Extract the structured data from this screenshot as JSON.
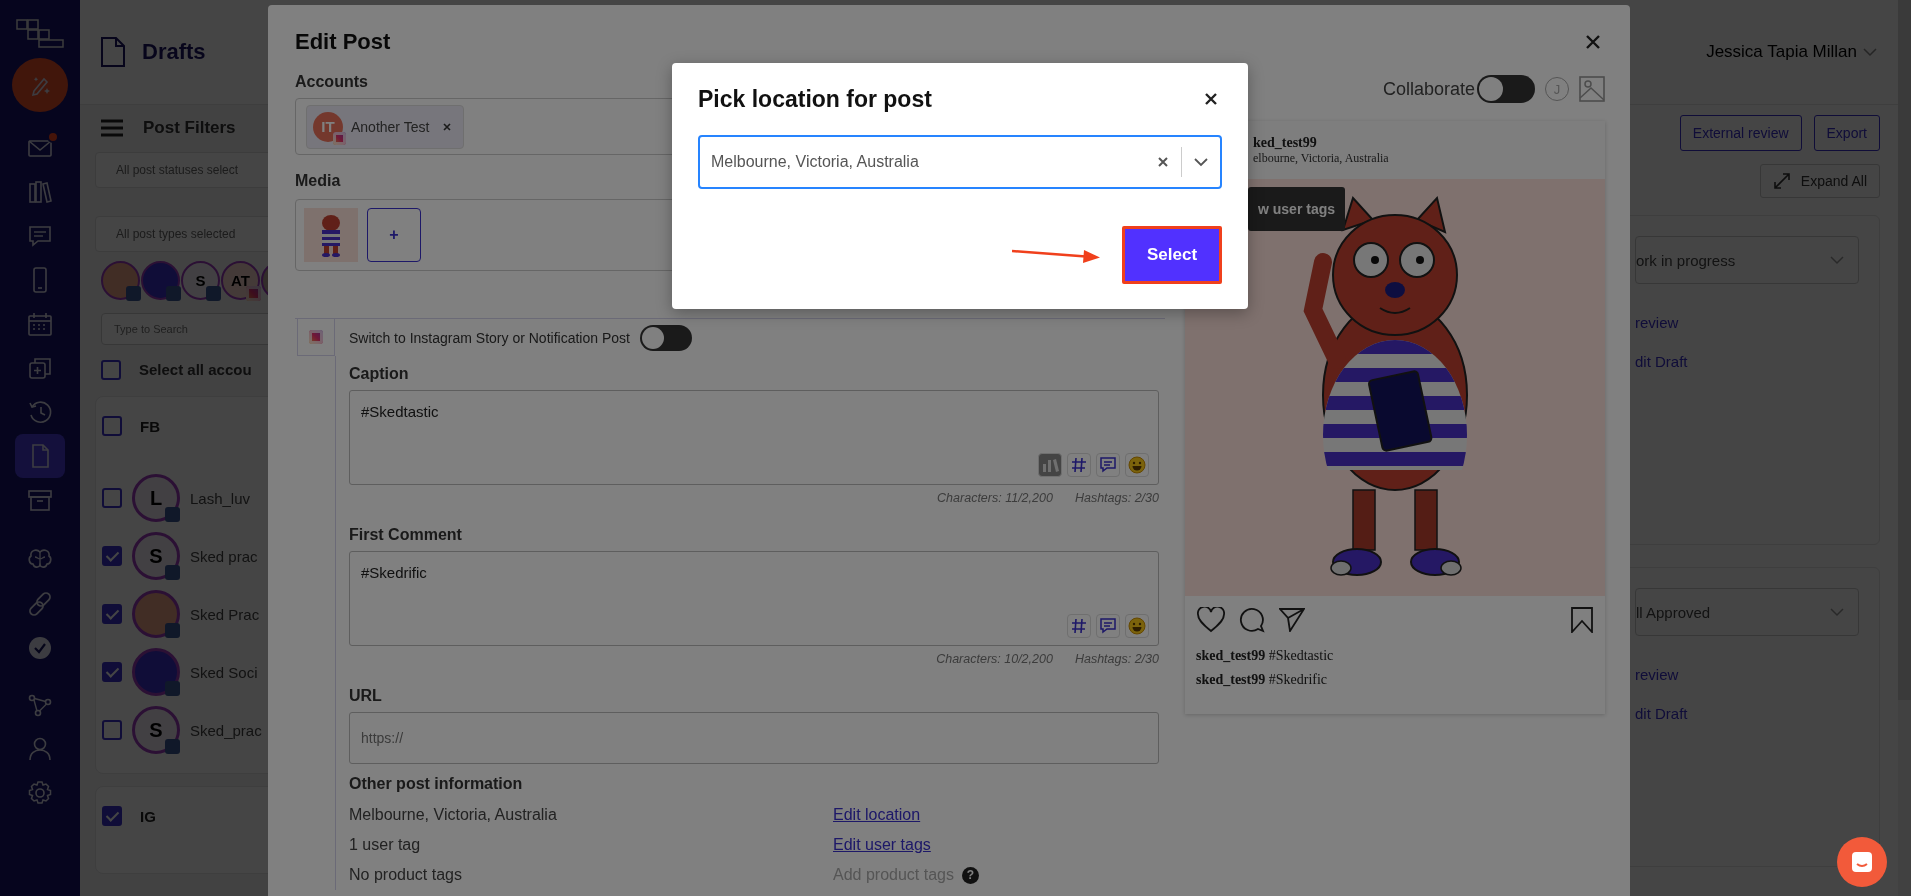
{
  "nav": {
    "items": [
      {
        "kind": "compose",
        "selected": false,
        "notification": false
      },
      {
        "kind": "mail",
        "selected": false,
        "notification": true
      },
      {
        "kind": "books",
        "selected": false,
        "notification": false
      },
      {
        "kind": "chat",
        "selected": false,
        "notification": false
      },
      {
        "kind": "phone",
        "selected": false,
        "notification": false
      },
      {
        "kind": "calendar",
        "selected": false,
        "notification": false
      },
      {
        "kind": "copy",
        "selected": false,
        "notification": false
      },
      {
        "kind": "history",
        "selected": false,
        "notification": false
      },
      {
        "kind": "document",
        "selected": true,
        "notification": false
      },
      {
        "kind": "archive",
        "selected": false,
        "notification": false
      },
      {
        "kind": "brain",
        "selected": false,
        "notification": false
      },
      {
        "kind": "link",
        "selected": false,
        "notification": false
      },
      {
        "kind": "check",
        "selected": false,
        "notification": false
      },
      {
        "kind": "share",
        "selected": false,
        "notification": false
      },
      {
        "kind": "user",
        "selected": false,
        "notification": false
      },
      {
        "kind": "gear",
        "selected": false,
        "notification": false
      }
    ]
  },
  "page": {
    "title": "Drafts",
    "user": "Jessica Tapia Millan",
    "filters": {
      "title": "Post Filters",
      "status_select": "All post statuses select",
      "type_select": "All post types selected",
      "search_placeholder": "Type to Search",
      "avatars": [
        {
          "kind": "art",
          "badge": {
            "kind": "facebook"
          }
        },
        {
          "kind": "logo",
          "badge": {
            "kind": "facebook"
          }
        },
        {
          "kind": "letter",
          "initials": "S",
          "badge": {
            "kind": "facebook"
          }
        },
        {
          "kind": "salmon",
          "initials": "AT",
          "badge": {
            "kind": "instagram"
          }
        },
        {
          "kind": "photo"
        }
      ],
      "select_all": {
        "label": "Select all accou",
        "checked": false
      },
      "groups": [
        {
          "name": "FB",
          "checked": false,
          "accounts": [
            {
              "name": "Lash_luv",
              "kind": "letter",
              "initials": "L",
              "checked": false
            },
            {
              "name": "Sked prac",
              "kind": "letter",
              "initials": "S",
              "checked": true
            },
            {
              "name": "Sked Prac",
              "kind": "art",
              "checked": true
            },
            {
              "name": "Sked Soci",
              "kind": "logo",
              "checked": true
            },
            {
              "name": "Sked_prac",
              "kind": "letter",
              "initials": "S",
              "checked": false
            }
          ]
        },
        {
          "name": "IG",
          "checked": true
        }
      ]
    },
    "actions": {
      "buttons": [
        "External review",
        "Export"
      ],
      "expand": "Expand All"
    },
    "cards": [
      {
        "status": "ork in progress",
        "links": [
          "review",
          "dit Draft"
        ]
      },
      {
        "status": "ll Approved",
        "links": [
          "review",
          "dit Draft"
        ]
      }
    ]
  },
  "edit_post": {
    "title": "Edit Post",
    "accounts_label": "Accounts",
    "accounts": [
      {
        "name": "Another Test",
        "initials": "IT"
      }
    ],
    "media_label": "Media",
    "add_media": "+",
    "story_switch": {
      "label": "Switch to Instagram Story or Notification Post",
      "on": false
    },
    "caption": {
      "label": "Caption",
      "value": "#Skedtastic",
      "characters": "Characters: 11/2,200",
      "hashtags": "Hashtags: 2/30",
      "tools": [
        {
          "kind": "library"
        },
        {
          "kind": "hashtag"
        },
        {
          "kind": "comment"
        },
        {
          "kind": "emoji"
        }
      ]
    },
    "first_comment": {
      "label": "First Comment",
      "value": "#Skedrific",
      "characters": "Characters: 10/2,200",
      "hashtags": "Hashtags: 2/30",
      "tools": [
        {
          "kind": "hashtag"
        },
        {
          "kind": "comment"
        },
        {
          "kind": "emoji"
        }
      ]
    },
    "url": {
      "label": "URL",
      "placeholder": "https://"
    },
    "other_info": {
      "title": "Other post information",
      "rows": [
        {
          "text": "Melbourne, Victoria, Australia",
          "action": "Edit location",
          "kind": "link"
        },
        {
          "text": "1 user tag",
          "action": "Edit user tags",
          "kind": "link"
        },
        {
          "text": "No product tags",
          "action": "Add product tags",
          "kind": "disabled",
          "help": "?"
        }
      ]
    },
    "collaborate": {
      "label": "Collaborate",
      "on": false,
      "initial": "J"
    },
    "preview": {
      "username": "ked_test99",
      "location": "elbourne, Victoria, Australia",
      "tag_button": "w user tags",
      "comments": [
        "**sked_test99** #Skedtastic",
        "**sked_test99** #Skedrific"
      ]
    }
  },
  "location_modal": {
    "title": "Pick location for post",
    "value": "Melbourne, Victoria, Australia",
    "button": "Select"
  }
}
